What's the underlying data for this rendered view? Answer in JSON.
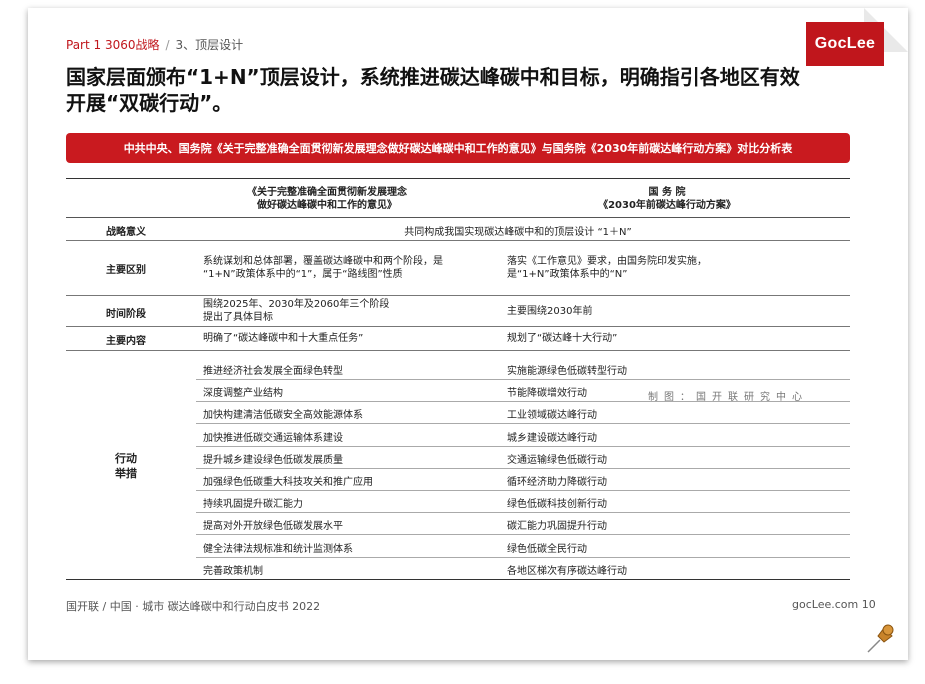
{
  "breadcrumb": {
    "part": "Part 1  3060战略",
    "sep": "/",
    "section": "3、顶层设计"
  },
  "logo": {
    "text": "GocLee",
    "color": "#c0161c"
  },
  "headline": "国家层面颁布“1+N”顶层设计，系统推进碳达峰碳中和目标，明确指引各地区有效开展“双碳行动”。",
  "banner": "中共中央、国务院《关于完整准确全面贯彻新发展理念做好碳达峰碳中和工作的意见》与国务院《2030年前碳达峰行动方案》对比分析表",
  "table": {
    "header_left_1": "《关于完整准确全面贯彻新发展理念",
    "header_left_2": "做好碳达峰碳中和工作的意见》",
    "header_right_1": "国 务 院",
    "header_right_2": "《2030年前碳达峰行动方案》",
    "rows": [
      {
        "label": "战略意义",
        "span": "共同构成我国实现碳达峰碳中和的顶层设计 “1＋N”"
      },
      {
        "label": "主要区别",
        "left_1": "系统谋划和总体部署，覆盖碳达峰碳中和两个阶段，是",
        "left_2": "“1+N”政策体系中的“1”，属于“路线图”性质",
        "right_1": "落实《工作意见》要求，由国务院印发实施，",
        "right_2": "是“1+N”政策体系中的“N”"
      },
      {
        "label": "时间阶段",
        "left_1": "围绕2025年、2030年及2060年三个阶段",
        "left_2": "提出了具体目标",
        "right": "主要围绕2030年前"
      },
      {
        "label": "主要内容",
        "left": "明确了“碳达峰碳中和十大重点任务”",
        "right": "规划了“碳达峰十大行动”"
      }
    ],
    "action_label_1": "行动",
    "action_label_2": "举措",
    "actions": [
      {
        "left": "推进经济社会发展全面绿色转型",
        "right": "实施能源绿色低碳转型行动"
      },
      {
        "left": "深度调整产业结构",
        "right": "节能降碳增效行动"
      },
      {
        "left": "加快构建清洁低碳安全高效能源体系",
        "right": "工业领域碳达峰行动"
      },
      {
        "left": "加快推进低碳交通运输体系建设",
        "right": "城乡建设碳达峰行动"
      },
      {
        "left": "提升城乡建设绿色低碳发展质量",
        "right": "交通运输绿色低碳行动"
      },
      {
        "left": "加强绿色低碳重大科技攻关和推广应用",
        "right": "循环经济助力降碳行动"
      },
      {
        "left": "持续巩固提升碳汇能力",
        "right": "绿色低碳科技创新行动"
      },
      {
        "left": "提高对外开放绿色低碳发展水平",
        "right": "碳汇能力巩固提升行动"
      },
      {
        "left": "健全法律法规标准和统计监测体系",
        "right": "绿色低碳全民行动"
      },
      {
        "left": "完善政策机制",
        "right": "各地区梯次有序碳达峰行动"
      }
    ]
  },
  "watermark": "制图：国开联研究中心",
  "footer": {
    "left": "国开联 / 中国 · 城市  碳达峰碳中和行动白皮书 2022",
    "right": "gocLee.com  10"
  },
  "colors": {
    "accent": "#c91a1f"
  },
  "icons": {
    "pin": "pushpin-icon"
  }
}
